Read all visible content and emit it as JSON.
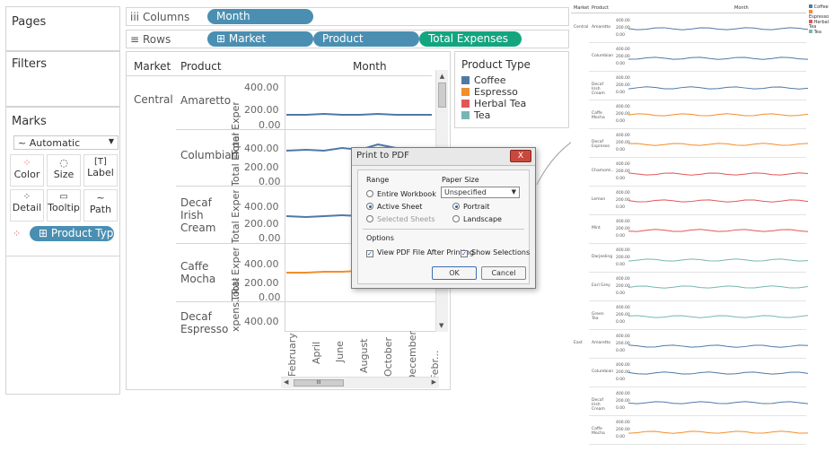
{
  "left": {
    "pages_label": "Pages",
    "filters_label": "Filters",
    "marks_label": "Marks",
    "marks_type": "Automatic",
    "mark_buttons": [
      "Color",
      "Size",
      "Label",
      "Detail",
      "Tooltip",
      "Path"
    ],
    "color_pill": "⊞ Product Type"
  },
  "shelves": {
    "columns_label": "Columns",
    "rows_label": "Rows",
    "columns_pills": [
      "Month"
    ],
    "rows_pills": [
      "⊞ Market",
      "Product",
      "Total Expenses"
    ]
  },
  "view": {
    "col_market": "Market",
    "col_product": "Product",
    "col_month": "Month",
    "market": "Central",
    "axis_label": "Total Expens..",
    "axis_label_cut": "xpens..Total Expens..",
    "products": [
      "Amaretto",
      "Columbian",
      "Decaf\nIrish\nCream",
      "Caffe\nMocha",
      "Decaf\nEspresso"
    ],
    "ticks": [
      "400.00",
      "200.00",
      "0.00"
    ],
    "months": [
      "February",
      "April",
      "June",
      "August",
      "October",
      "December",
      "Febr..."
    ],
    "scroll_marker": "III"
  },
  "legend": {
    "title": "Product Type",
    "items": [
      {
        "label": "Coffee",
        "color": "#4e79a7"
      },
      {
        "label": "Espresso",
        "color": "#f28e2b"
      },
      {
        "label": "Herbal Tea",
        "color": "#e15759"
      },
      {
        "label": "Tea",
        "color": "#76b7b2"
      }
    ]
  },
  "dialog": {
    "title": "Print to PDF",
    "close": "X",
    "range_label": "Range",
    "range_options": [
      "Entire Workbook",
      "Active Sheet",
      "Selected Sheets"
    ],
    "paper_label": "Paper Size",
    "paper_value": "Unspecified",
    "orient_options": [
      "Portrait",
      "Landscape"
    ],
    "options_label": "Options",
    "opt_view_pdf": "View PDF File After Printing",
    "opt_show_sel": "Show Selections",
    "ok": "OK",
    "cancel": "Cancel"
  },
  "preview": {
    "header_market": "Market",
    "header_product": "Product",
    "header_month": "Month",
    "markets": [
      "Central",
      "East"
    ],
    "rows": [
      {
        "market": "Central",
        "product": "Amaretto",
        "type": "Coffee"
      },
      {
        "market": "",
        "product": "Columbian",
        "type": "Coffee"
      },
      {
        "market": "",
        "product": "Decaf Irish Cream",
        "type": "Coffee"
      },
      {
        "market": "",
        "product": "Caffe Mocha",
        "type": "Espresso"
      },
      {
        "market": "",
        "product": "Decaf Espresso",
        "type": "Espresso"
      },
      {
        "market": "",
        "product": "Chamomi..",
        "type": "Herbal Tea"
      },
      {
        "market": "",
        "product": "Lemon",
        "type": "Herbal Tea"
      },
      {
        "market": "",
        "product": "Mint",
        "type": "Herbal Tea"
      },
      {
        "market": "",
        "product": "Darjeeling",
        "type": "Tea"
      },
      {
        "market": "",
        "product": "Earl Grey",
        "type": "Tea"
      },
      {
        "market": "",
        "product": "Green Tea",
        "type": "Tea"
      },
      {
        "market": "East",
        "product": "Amaretto",
        "type": "Coffee"
      },
      {
        "market": "",
        "product": "Columbian",
        "type": "Coffee"
      },
      {
        "market": "",
        "product": "Decaf Irish Cream",
        "type": "Coffee"
      },
      {
        "market": "",
        "product": "Caffe Mocha",
        "type": "Espresso"
      }
    ],
    "ticks": [
      "400.00",
      "200.00",
      "0.00"
    ],
    "legend": [
      "Coffee",
      "Espresso",
      "Herbal Tea",
      "Tea"
    ]
  }
}
